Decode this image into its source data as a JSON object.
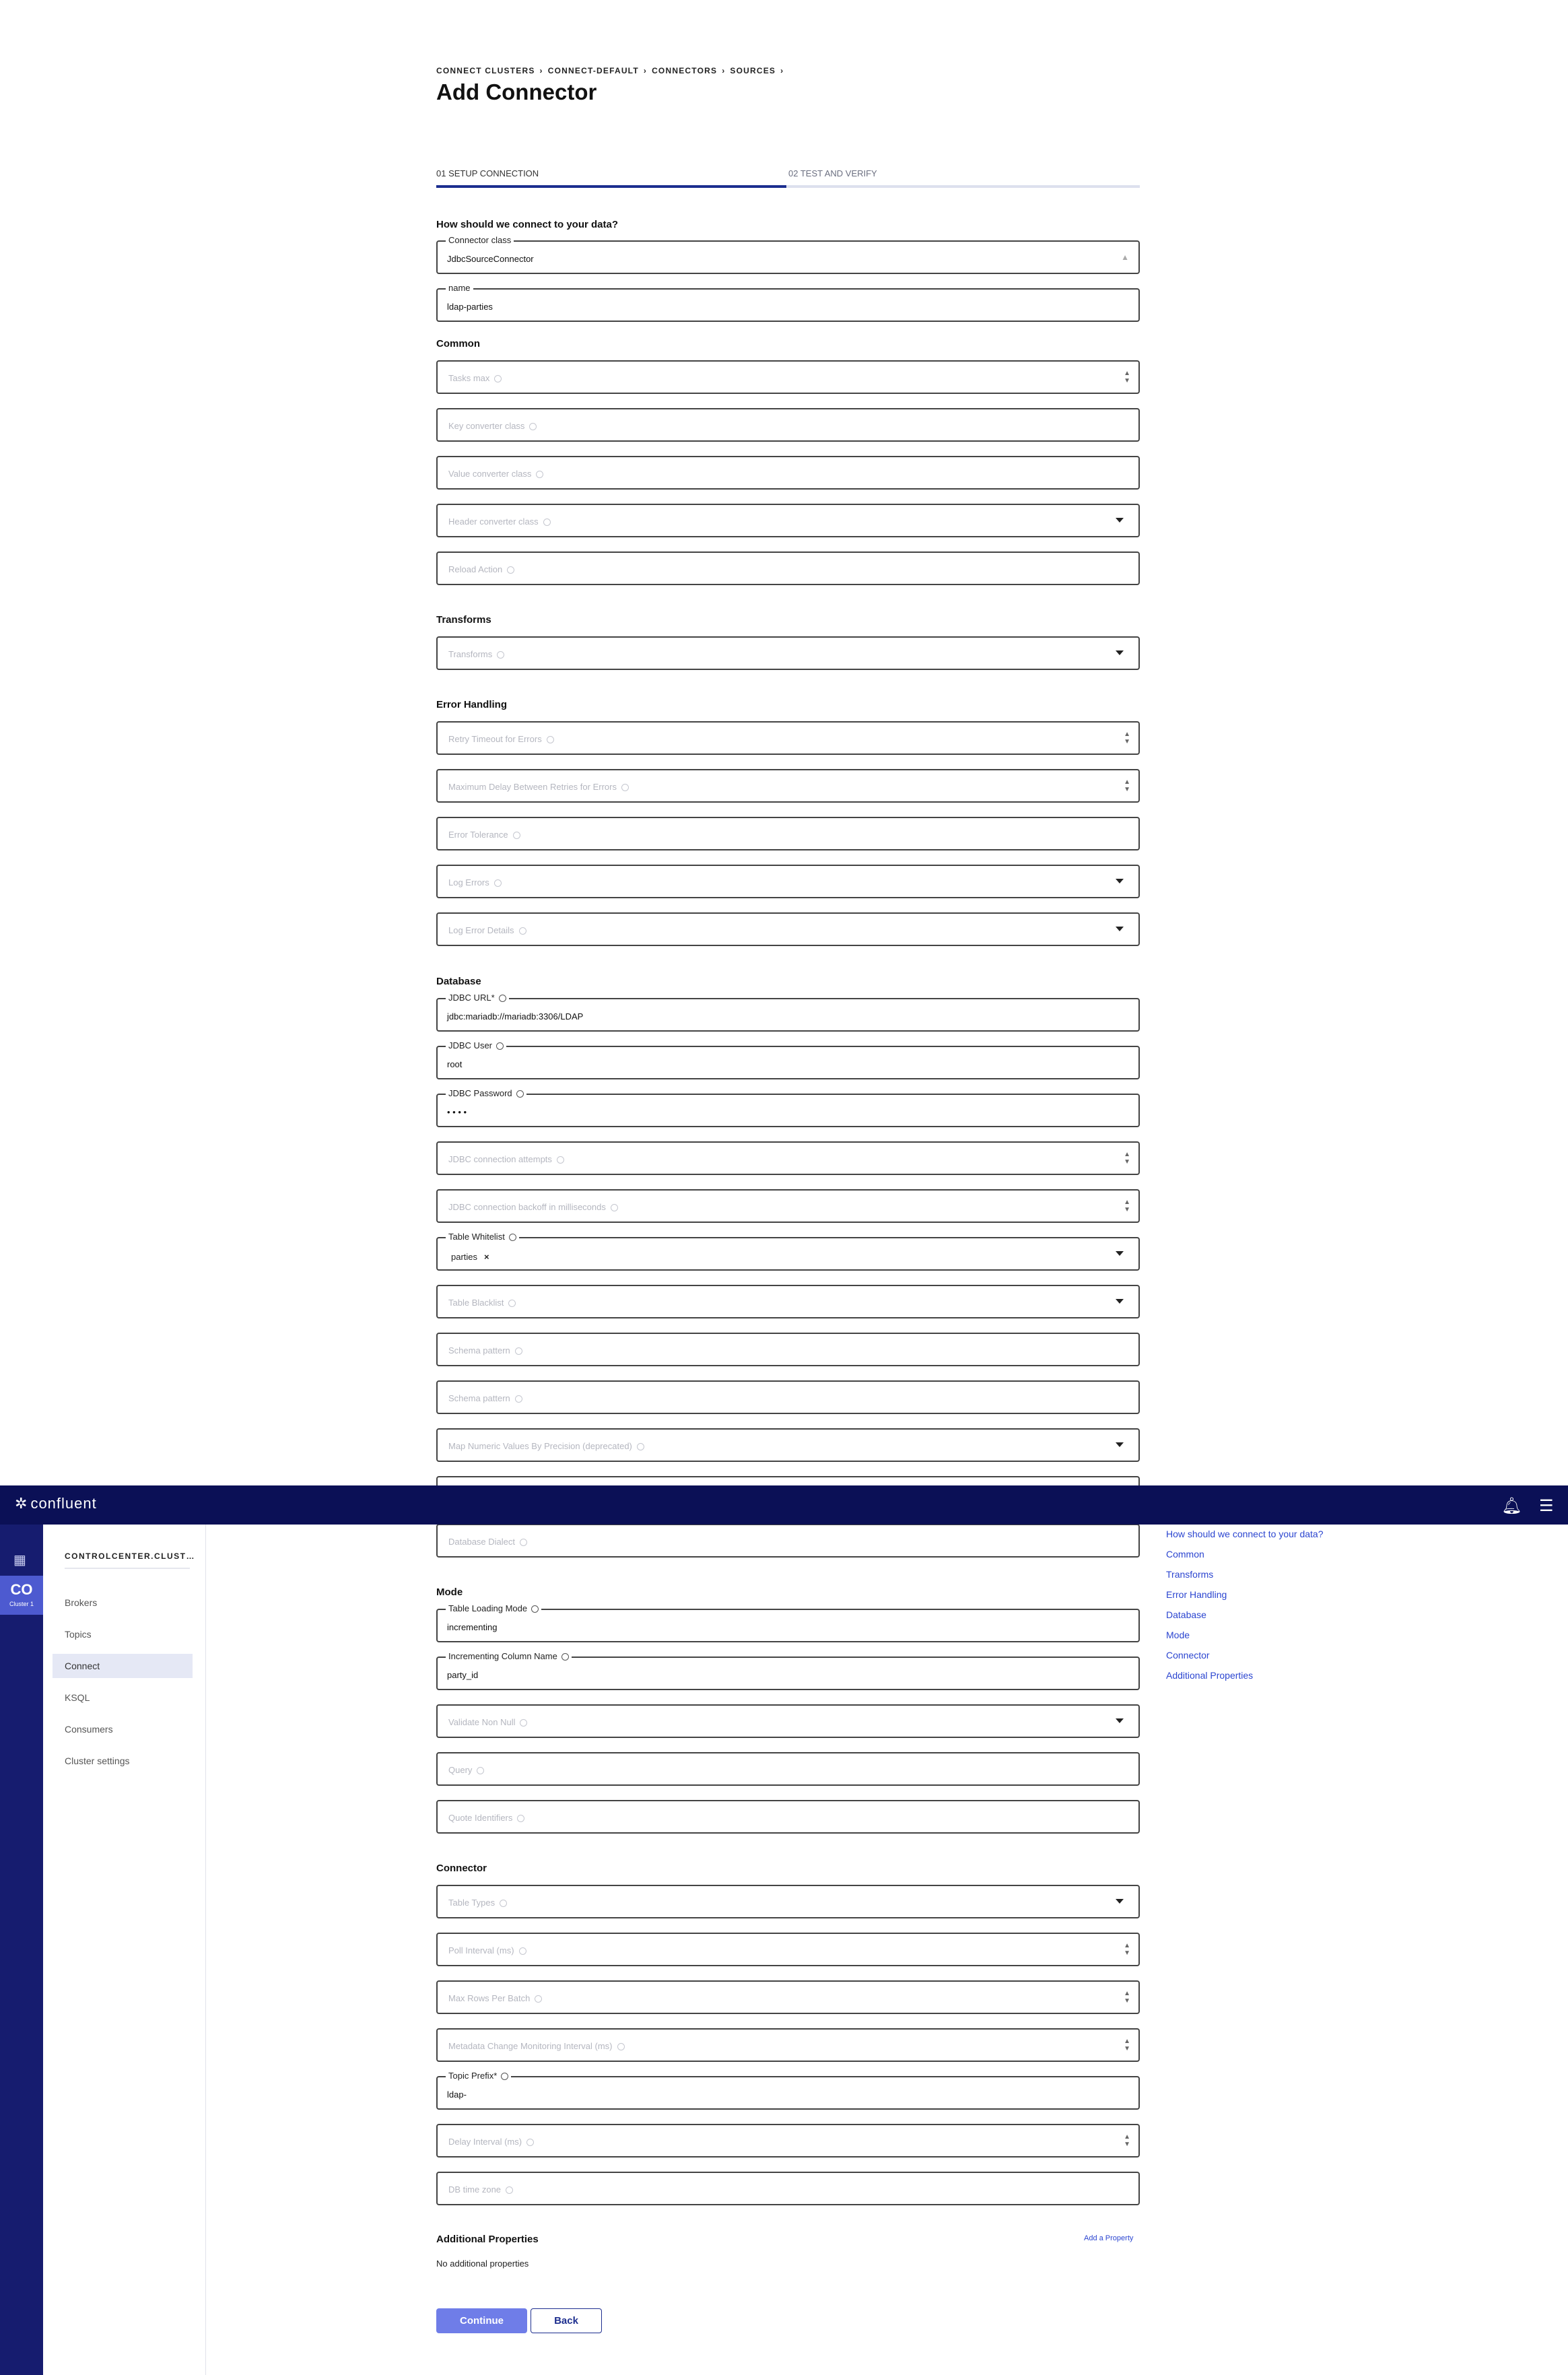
{
  "header": {
    "logo": "confluent",
    "logo_icon": "confluent-logo-icon",
    "bell_icon": "bell-icon",
    "menu_icon": "hamburger-icon"
  },
  "rail": {
    "grid_icon": "apps-grid-icon",
    "cluster_abbr": "CO",
    "cluster_sub": "Cluster 1"
  },
  "sidenav": {
    "cluster_name": "CONTROLCENTER.CLUST…",
    "items": [
      "Brokers",
      "Topics",
      "Connect",
      "KSQL",
      "Consumers",
      "Cluster settings"
    ],
    "active": "Connect"
  },
  "breadcrumb": [
    "CONNECT CLUSTERS",
    "CONNECT-DEFAULT",
    "CONNECTORS",
    "SOURCES"
  ],
  "page_title": "Add Connector",
  "steps": [
    "01 SETUP CONNECTION",
    "02 TEST AND VERIFY"
  ],
  "progress": {
    "current_step": 1,
    "total_steps": 2
  },
  "sections": {
    "connect": "How should we connect to your data?",
    "common": "Common",
    "transforms": "Transforms",
    "error_handling": "Error Handling",
    "database": "Database",
    "mode": "Mode",
    "connector": "Connector",
    "additional": "Additional Properties"
  },
  "fields": {
    "connector_class": {
      "label": "Connector class",
      "value": "JdbcSourceConnector"
    },
    "name": {
      "label": "name",
      "value": "ldap-parties"
    },
    "tasks_max": "Tasks max",
    "key_converter": "Key converter class",
    "value_converter": "Value converter class",
    "header_converter": "Header converter class",
    "reload_action": "Reload Action",
    "transforms": "Transforms",
    "retry_timeout": "Retry Timeout for Errors",
    "max_delay": "Maximum Delay Between Retries for Errors",
    "error_tolerance": "Error Tolerance",
    "log_errors": "Log Errors",
    "log_error_details": "Log Error Details",
    "jdbc_url": {
      "label": "JDBC URL*",
      "value": "jdbc:mariadb://mariadb:3306/LDAP"
    },
    "jdbc_user": {
      "label": "JDBC User",
      "value": "root"
    },
    "jdbc_password": {
      "label": "JDBC Password",
      "value": "• • • •"
    },
    "conn_attempts": "JDBC connection attempts",
    "conn_backoff": "JDBC connection backoff in milliseconds",
    "table_whitelist": {
      "label": "Table Whitelist",
      "chip": "parties",
      "chip_remove": "×"
    },
    "table_blacklist": "Table Blacklist",
    "schema_pattern_1": "Schema pattern",
    "schema_pattern_2": "Schema pattern",
    "map_numeric": "Map Numeric Values By Precision (deprecated)",
    "database_dialect": "Database Dialect",
    "table_loading_mode": {
      "label": "Table Loading Mode",
      "value": "incrementing"
    },
    "incrementing_column": {
      "label": "Incrementing Column Name",
      "value": "party_id"
    },
    "validate_non_null": "Validate Non Null",
    "query": "Query",
    "quote_identifiers": "Quote Identifiers",
    "table_types": "Table Types",
    "poll_interval": "Poll Interval (ms)",
    "max_rows": "Max Rows Per Batch",
    "metadata_monitoring": "Metadata Change Monitoring Interval (ms)",
    "topic_prefix": {
      "label": "Topic Prefix*",
      "value": "ldap-"
    },
    "delay_interval": "Delay Interval (ms)",
    "db_time_zone": "DB time zone"
  },
  "toc": [
    "How should we connect to your data?",
    "Common",
    "Transforms",
    "Error Handling",
    "Database",
    "Mode",
    "Connector",
    "Additional Properties"
  ],
  "additional": {
    "add_link": "Add a Property",
    "empty_text": "No additional properties"
  },
  "buttons": {
    "continue": "Continue",
    "back": "Back"
  },
  "colors": {
    "topbar": "#0b1056",
    "rail": "#161c6f",
    "accent": "#1c2e8f",
    "primary_button": "#6f7de8",
    "link": "#2b45d0"
  }
}
